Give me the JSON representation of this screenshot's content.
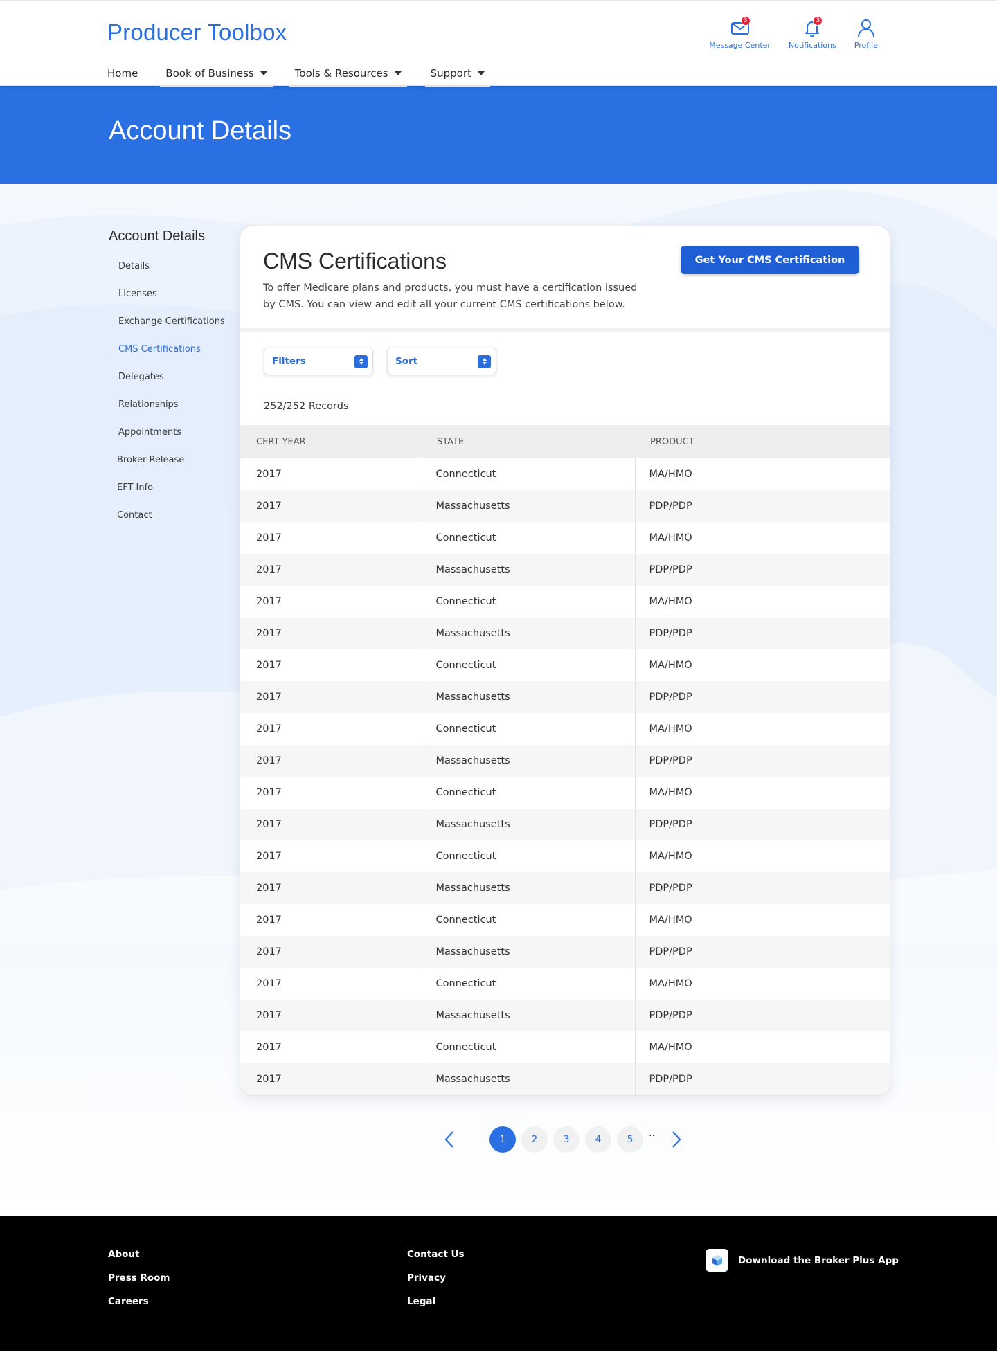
{
  "header": {
    "brand": "Producer Toolbox",
    "nav": [
      {
        "label": "Home"
      },
      {
        "label": "Book of Business"
      },
      {
        "label": "Tools & Resources"
      },
      {
        "label": "Support"
      }
    ],
    "icons": {
      "messages": {
        "label": "Message Center",
        "count": "3",
        "icon": "mail-icon"
      },
      "notifications": {
        "label": "Notifications",
        "count": "3",
        "icon": "bell-icon"
      },
      "profile": {
        "label": "Profile",
        "icon": "user-icon"
      }
    }
  },
  "hero": {
    "title": "Account Details"
  },
  "sidebar": {
    "title": "Account Details",
    "items": [
      {
        "label": "Details"
      },
      {
        "label": "Licenses"
      },
      {
        "label": "Exchange Certifications"
      },
      {
        "label": "CMS Certifications",
        "active": true
      },
      {
        "label": "Delegates"
      },
      {
        "label": "Relationships"
      },
      {
        "label": "Appointments"
      },
      {
        "label": "Broker Release"
      },
      {
        "label": "EFT Info"
      },
      {
        "label": "Contact"
      }
    ]
  },
  "main": {
    "title": "CMS Certifications",
    "description": "To offer Medicare plans and products, you must have a certification issued by CMS. You can view and edit all your current CMS certifications below.",
    "cta_label": "Get Your CMS Certification",
    "filters_label": "Filters",
    "sort_label": "Sort",
    "records_text": "252/252 Records",
    "table": {
      "columns": [
        "CERT YEAR",
        "STATE",
        "PRODUCT"
      ],
      "rows": [
        [
          "2017",
          "Connecticut",
          "MA/HMO"
        ],
        [
          "2017",
          "Massachusetts",
          "PDP/PDP"
        ],
        [
          "2017",
          "Connecticut",
          "MA/HMO"
        ],
        [
          "2017",
          "Massachusetts",
          "PDP/PDP"
        ],
        [
          "2017",
          "Connecticut",
          "MA/HMO"
        ],
        [
          "2017",
          "Massachusetts",
          "PDP/PDP"
        ],
        [
          "2017",
          "Connecticut",
          "MA/HMO"
        ],
        [
          "2017",
          "Massachusetts",
          "PDP/PDP"
        ],
        [
          "2017",
          "Connecticut",
          "MA/HMO"
        ],
        [
          "2017",
          "Massachusetts",
          "PDP/PDP"
        ],
        [
          "2017",
          "Connecticut",
          "MA/HMO"
        ],
        [
          "2017",
          "Massachusetts",
          "PDP/PDP"
        ],
        [
          "2017",
          "Connecticut",
          "MA/HMO"
        ],
        [
          "2017",
          "Massachusetts",
          "PDP/PDP"
        ],
        [
          "2017",
          "Connecticut",
          "MA/HMO"
        ],
        [
          "2017",
          "Massachusetts",
          "PDP/PDP"
        ],
        [
          "2017",
          "Connecticut",
          "MA/HMO"
        ],
        [
          "2017",
          "Massachusetts",
          "PDP/PDP"
        ],
        [
          "2017",
          "Connecticut",
          "MA/HMO"
        ],
        [
          "2017",
          "Massachusetts",
          "PDP/PDP"
        ]
      ]
    }
  },
  "pagination": {
    "pages": [
      "1",
      "2",
      "3",
      "4",
      "5"
    ],
    "current": "1",
    "ellipsis": ".."
  },
  "footer": {
    "col1": [
      "About",
      "Press Room",
      "Careers"
    ],
    "col2": [
      "Contact Us",
      "Privacy",
      "Legal"
    ],
    "app_label": "Download the Broker Plus App"
  },
  "colors": {
    "brand_blue": "#2a6fdb",
    "hero_blue": "#2a70e2",
    "cta_blue": "#1e5fd6",
    "badge_red": "#e0243c",
    "footer_bg": "#000000"
  }
}
